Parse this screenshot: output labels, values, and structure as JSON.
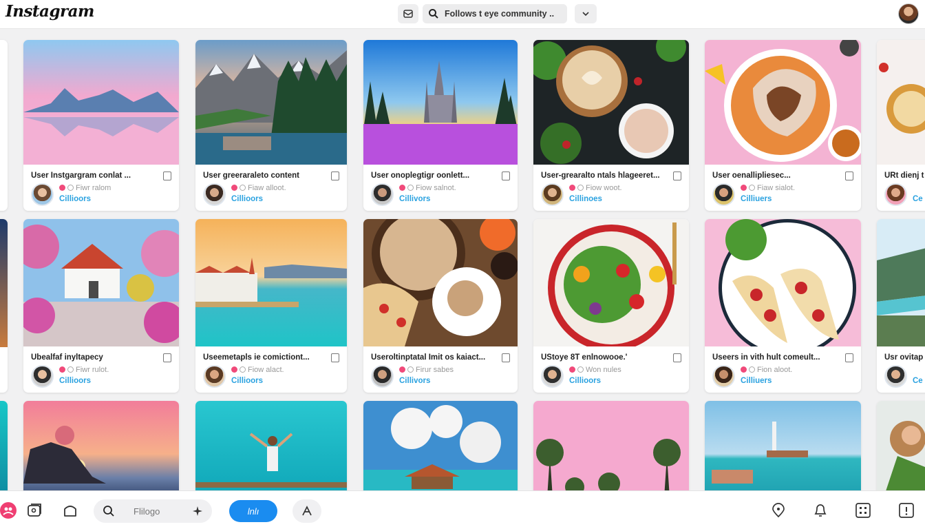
{
  "app": {
    "name": "Instagram"
  },
  "topbar": {
    "search_text": "Follows t eye community .."
  },
  "rows": [
    {
      "cards": [
        {
          "title": "User Instgargram conlat ...",
          "sub": "Fiwr ralom",
          "followers": "Cillioors"
        },
        {
          "title": "User greeraraleto content",
          "sub": "Fiaw alloot.",
          "followers": "Cillioors"
        },
        {
          "title": "User onoplegtigr oonlett...",
          "sub": "Fiow salnot.",
          "followers": "Cillivors"
        },
        {
          "title": "User-grearalto ntals hlageeret...",
          "sub": "Fiow woot.",
          "followers": "Cillinoes"
        },
        {
          "title": "User oenallipliesec...",
          "sub": "Fiaw sialot.",
          "followers": "Cilliuers"
        },
        {
          "title": "URt dienj t",
          "sub": "",
          "followers": "Ce"
        }
      ]
    },
    {
      "cards": [
        {
          "title": "Ubealfaf inyltapecy",
          "sub": "Fiwr rulot.",
          "followers": "Cillioors"
        },
        {
          "title": "Useemetapls ie comictiont...",
          "sub": "Fiow alact.",
          "followers": "Cillioors"
        },
        {
          "title": "Useroltinptatal Imit os kaiact...",
          "sub": "Firur sabes",
          "followers": "Cillivors"
        },
        {
          "title": "UStoye 8T enlnowooe.'",
          "sub": "Won nules",
          "followers": "Cillioors"
        },
        {
          "title": "Useers in vith hult comeult...",
          "sub": "Fion aloot.",
          "followers": "Cilliuers"
        },
        {
          "title": "Usr ovitap",
          "sub": "",
          "followers": "Ce"
        }
      ]
    }
  ],
  "bottombar": {
    "search_placeholder": "Flilogo",
    "active_label": "lnlı"
  }
}
